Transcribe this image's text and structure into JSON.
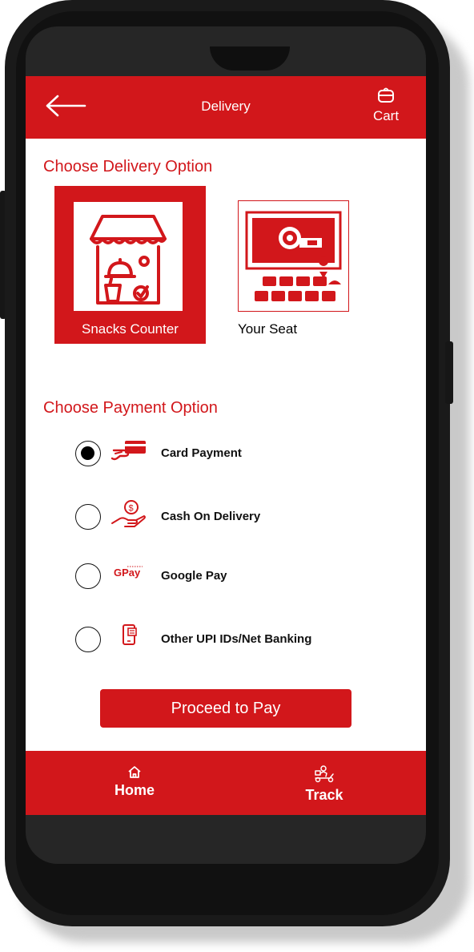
{
  "header": {
    "title": "Delivery",
    "cart_label": "Cart"
  },
  "delivery": {
    "section_title": "Choose Delivery Option",
    "options": [
      {
        "label": "Snacks Counter",
        "selected": true,
        "icon": "snacks-counter-icon"
      },
      {
        "label": "Your Seat",
        "selected": false,
        "icon": "seat-delivery-icon"
      }
    ]
  },
  "payment": {
    "section_title": "Choose Payment Option",
    "options": [
      {
        "label": "Card Payment",
        "selected": true,
        "icon": "card-payment-icon"
      },
      {
        "label": "Cash On Delivery",
        "selected": false,
        "icon": "cash-hand-icon"
      },
      {
        "label": "Google Pay",
        "selected": false,
        "icon": "google-pay-icon",
        "icon_text": "GPay"
      },
      {
        "label": "Other UPI IDs/Net Banking",
        "selected": false,
        "icon": "mobile-banking-icon"
      }
    ]
  },
  "proceed_label": "Proceed to Pay",
  "footer": {
    "home_label": "Home",
    "track_label": "Track"
  },
  "colors": {
    "brand": "#d2171b",
    "background": "#ffffff",
    "frame": "#1a1a1a"
  }
}
